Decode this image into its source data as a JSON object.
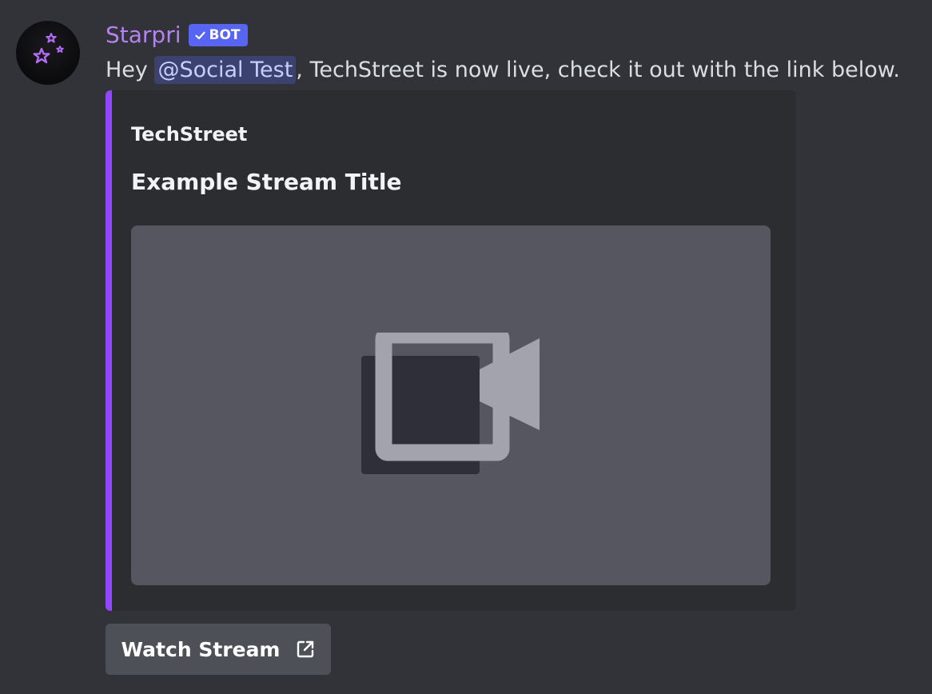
{
  "message": {
    "author": {
      "username": "Starpri",
      "bot_tag": "BOT",
      "avatar_icon": "sparkle-stars-icon",
      "username_color": "#b583f0"
    },
    "content": {
      "prefix": "Hey ",
      "mention": "@Social Test",
      "suffix": ", TechStreet is now live, check it out with the link below."
    },
    "embed": {
      "accent_color": "#9146ff",
      "author_name": "TechStreet",
      "title": "Example Stream Title",
      "media_icon": "video-camera-icon"
    },
    "button": {
      "label": "Watch Stream",
      "icon": "external-link-icon"
    }
  },
  "colors": {
    "background": "#313338",
    "embed_background": "#2b2d31",
    "bot_tag": "#5865f2",
    "mention_background": "#3c4270",
    "button_background": "#4e5058"
  }
}
